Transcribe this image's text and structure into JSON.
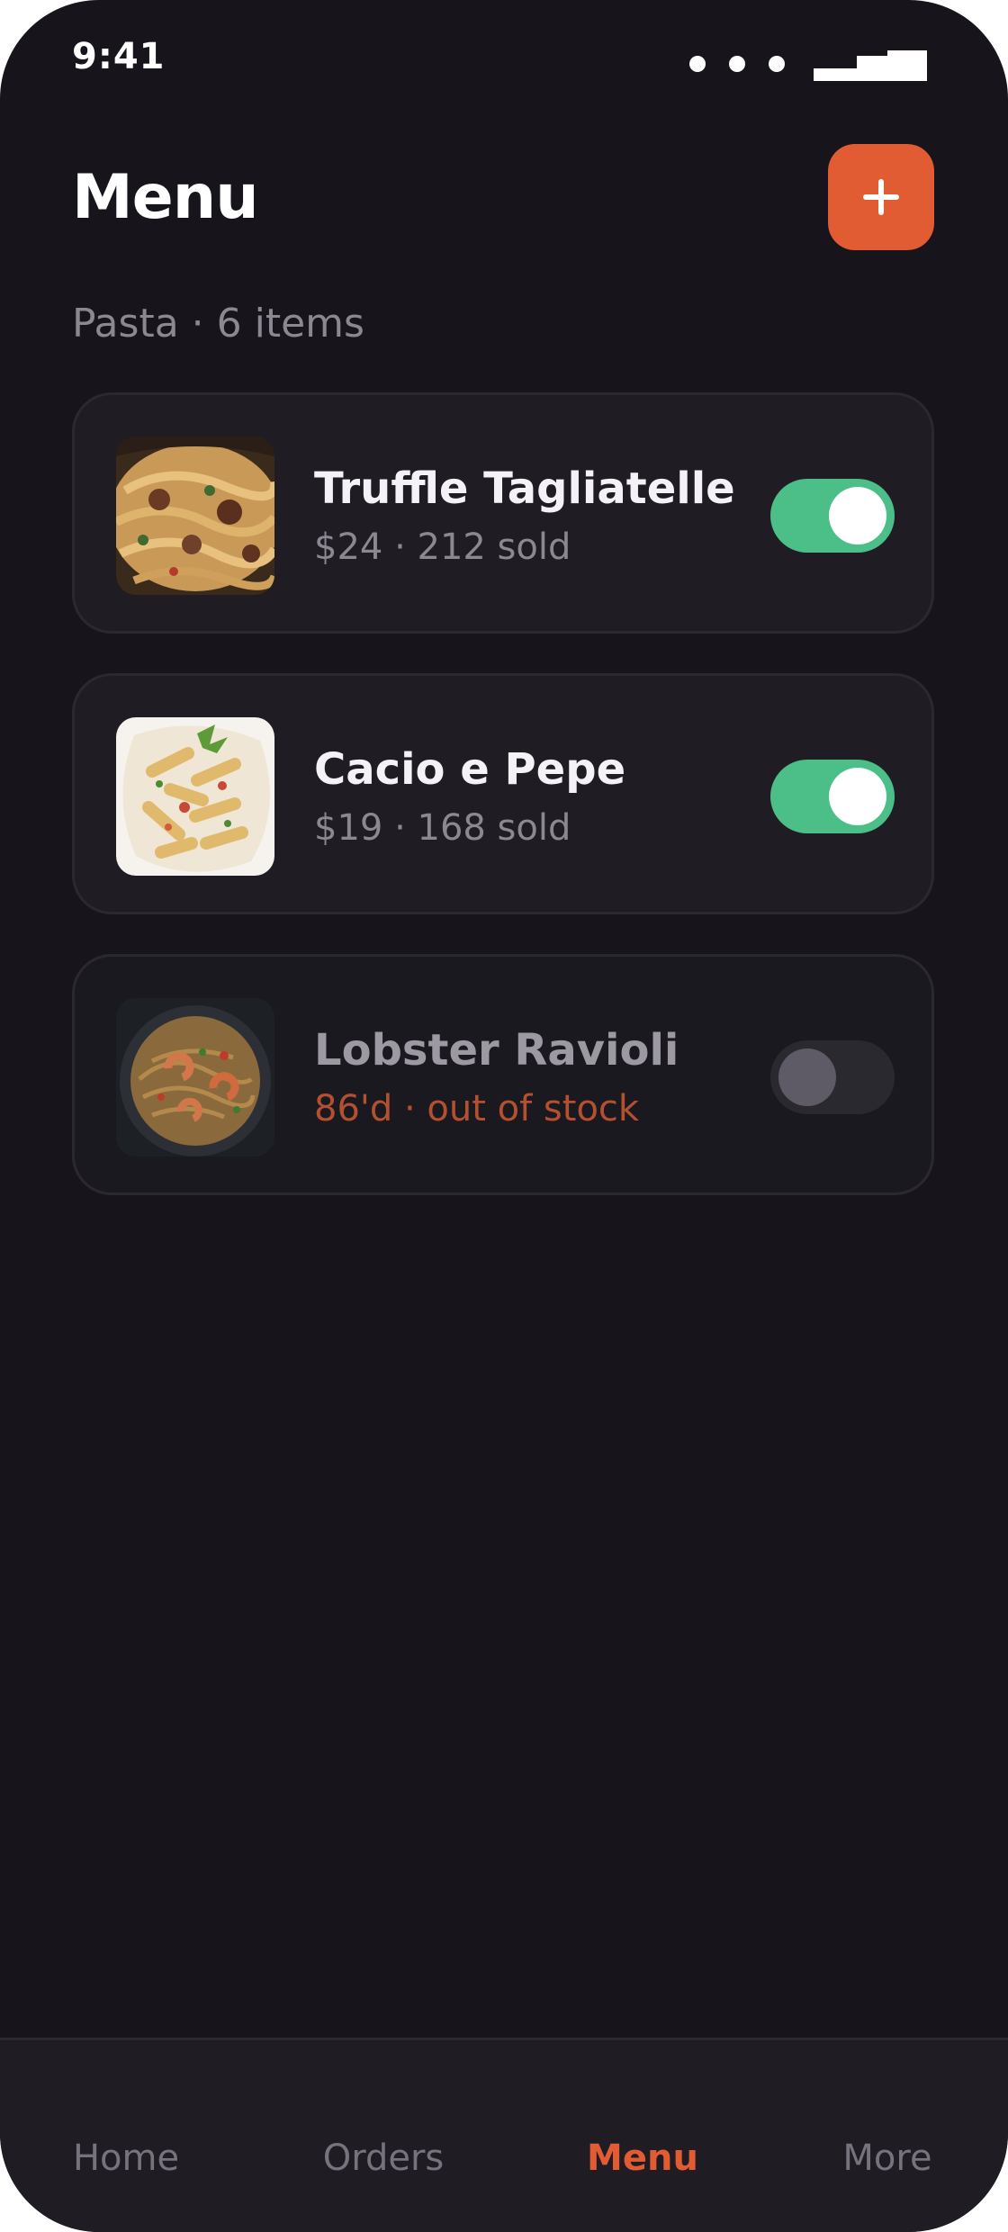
{
  "status_bar": {
    "time": "9:41"
  },
  "header": {
    "title": "Menu",
    "add_icon": "plus-icon"
  },
  "category": {
    "label": "Pasta · 6 items"
  },
  "items": [
    {
      "name": "Truffle Tagliatelle",
      "meta": "$24 · 212 sold",
      "available": true,
      "thumb_icon": "tagliatelle-dish-photo"
    },
    {
      "name": "Cacio e Pepe",
      "meta": "$19 · 168 sold",
      "available": true,
      "thumb_icon": "penne-dish-photo"
    },
    {
      "name": "Lobster Ravioli",
      "meta": "86'd · out of stock",
      "available": false,
      "thumb_icon": "seafood-pasta-photo"
    }
  ],
  "tab_bar": {
    "tabs": [
      {
        "label": "Home",
        "active": false
      },
      {
        "label": "Orders",
        "active": false
      },
      {
        "label": "Menu",
        "active": true
      },
      {
        "label": "More",
        "active": false
      }
    ]
  },
  "colors": {
    "background": "#17151b",
    "card": "#1f1c24",
    "accent": "#e25c33",
    "toggle_on": "#4cbf88",
    "muted_text": "#8c8892",
    "out_of_stock": "#b4502f"
  }
}
